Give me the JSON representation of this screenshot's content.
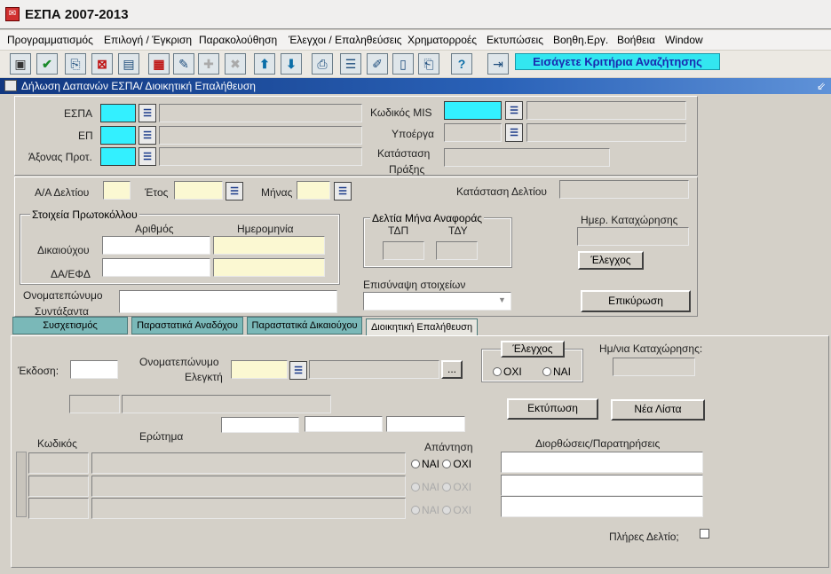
{
  "app": {
    "title": "ΕΣΠΑ 2007-2013"
  },
  "menu": [
    "Προγραμματισμός",
    "Επιλογή / Έγκριση",
    "Παρακολούθηση",
    "Έλεγχοι / Επαληθεύσεις",
    "Χρηματορροές",
    "Εκτυπώσεις",
    "Βοηθη.Εργ.",
    "Βοήθεια",
    "Window"
  ],
  "toolbar": {
    "hint": "Εισάγετε Κριτήρια Αναζήτησης"
  },
  "window": {
    "title": "Δήλωση Δαπανών ΕΣΠΑ/ Διοικητική Επαλήθευση",
    "minimize": "⇙"
  },
  "header": {
    "espa_label": "ΕΣΠΑ",
    "ep_label": "ΕΠ",
    "axonas_label": "Άξονας Προτ.",
    "mis_label": "Κωδικός MIS",
    "ypoerga_label": "Υποέργα",
    "katastasi_praxis_label1": "Κατάσταση",
    "katastasi_praxis_label2": "Πράξης"
  },
  "deltio": {
    "aa_label": "Α/Α Δελτίου",
    "etos_label": "Έτος",
    "minas_label": "Μήνας",
    "katastasi_label": "Κατάσταση Δελτίου",
    "protokollo_title": "Στοιχεία Πρωτοκόλλου",
    "arithmos_label": "Αριθμός",
    "imerominia_label": "Ημερομηνία",
    "dikaiouxou_label": "Δικαιούχου",
    "daefd_label": "ΔΑ/ΕΦΔ",
    "deltia_title": "Δελτία Μήνα Αναφοράς",
    "tdp_label": "ΤΔΠ",
    "tdy_label": "ΤΔΥ",
    "imer_kataxorisis_label": "Ημερ. Καταχώρησης",
    "elegxos_button": "Έλεγχος",
    "syntaxanta_label1": "Ονοματεπώνυμο",
    "syntaxanta_label2": "Συντάξαντα",
    "episynapsi_label": "Επισύναψη στοιχείων",
    "epikyrosi_button": "Επικύρωση"
  },
  "tabs": [
    "Συσχετισμός",
    "Παραστατικά Αναδόχου",
    "Παραστατικά Δικαιούχου",
    "Διοικητική Επαλήθευση"
  ],
  "verification": {
    "ekdosi_label": "Έκδοση:",
    "elegkti_label1": "Ονοματεπώνυμο",
    "elegkti_label2": "Ελεγκτή",
    "ellipsis": "...",
    "elegxos_title": "Έλεγχος",
    "oxi": "ΟΧΙ",
    "nai": "ΝΑΙ",
    "imnia_label": "Ημ/νια Καταχώρησης:",
    "ektyposi_button": "Εκτύπωση",
    "nea_lista_button": "Νέα Λίστα",
    "kodikos_label": "Κωδικός",
    "erotima_label": "Ερώτημα",
    "apantisi_label": "Απάντηση",
    "diorthoseis_label": "Διορθώσεις/Παρατηρήσεις",
    "pliris_label": "Πλήρες  Δελτίο;"
  }
}
